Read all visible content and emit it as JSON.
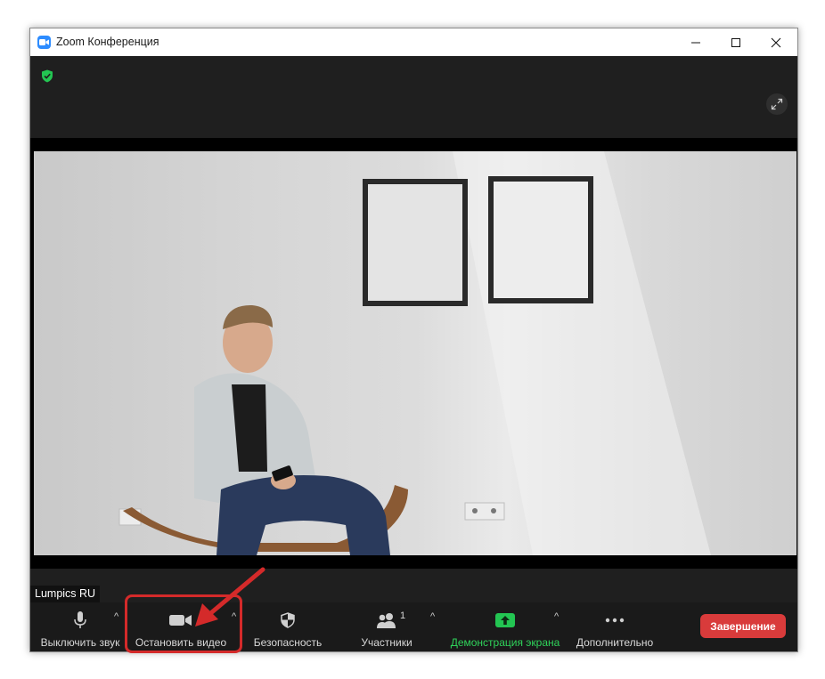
{
  "window": {
    "title": "Zoom Конференция",
    "app_icon": "zoom-icon",
    "controls": [
      "minimize-icon",
      "maximize-icon",
      "close-icon"
    ]
  },
  "meeting": {
    "security_badge_icon": "shield-check-icon",
    "security_badge_color": "#23c552",
    "fullscreen_icon": "expand-icon",
    "participant_name": "Lumpics RU"
  },
  "toolbar": {
    "mute_label": "Выключить звук",
    "stop_video_label": "Остановить видео",
    "security_label": "Безопасность",
    "participants_label": "Участники",
    "participants_count": "1",
    "share_label": "Демонстрация экрана",
    "more_label": "Дополнительно",
    "end_label": "Завершение",
    "caret": "^"
  },
  "colors": {
    "accent_share": "#2fd35a",
    "end_button": "#d93b3b",
    "highlight": "#d42a2a"
  }
}
